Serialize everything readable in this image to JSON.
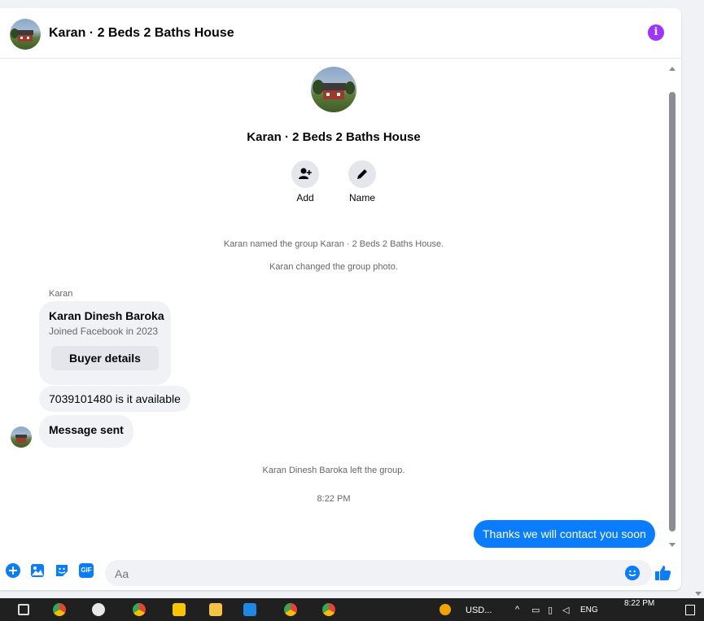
{
  "header": {
    "title": "Karan · 2 Beds 2 Baths House"
  },
  "group": {
    "name": "Karan · 2 Beds 2 Baths House",
    "actions": [
      {
        "label": "Add",
        "icon": "add-person-icon"
      },
      {
        "label": "Name",
        "icon": "pencil-icon"
      }
    ]
  },
  "system_messages": [
    "Karan named the group Karan · 2 Beds 2 Baths House.",
    "Karan changed the group photo.",
    "Karan Dinesh Baroka left the group."
  ],
  "messages": {
    "sender": "Karan",
    "card": {
      "name": "Karan Dinesh Baroka",
      "subtitle": "Joined Facebook in 2023",
      "button": "Buyer details"
    },
    "text1": "7039101480 is it available",
    "text2": "Message sent",
    "timestamp": "8:22 PM",
    "outgoing": "Thanks we will contact you soon"
  },
  "composer": {
    "placeholder": "Aa",
    "icons": [
      "plus-icon",
      "photo-icon",
      "sticker-icon",
      "gif-icon",
      "emoji-icon",
      "like-icon"
    ],
    "gif_label": "GIF"
  },
  "taskbar": {
    "currency": "USD...",
    "language": "ENG",
    "clock": "8:22 PM"
  },
  "colors": {
    "accent": "#0a7cff",
    "info": "#a033ff",
    "bubble_bg": "#f0f2f5"
  }
}
